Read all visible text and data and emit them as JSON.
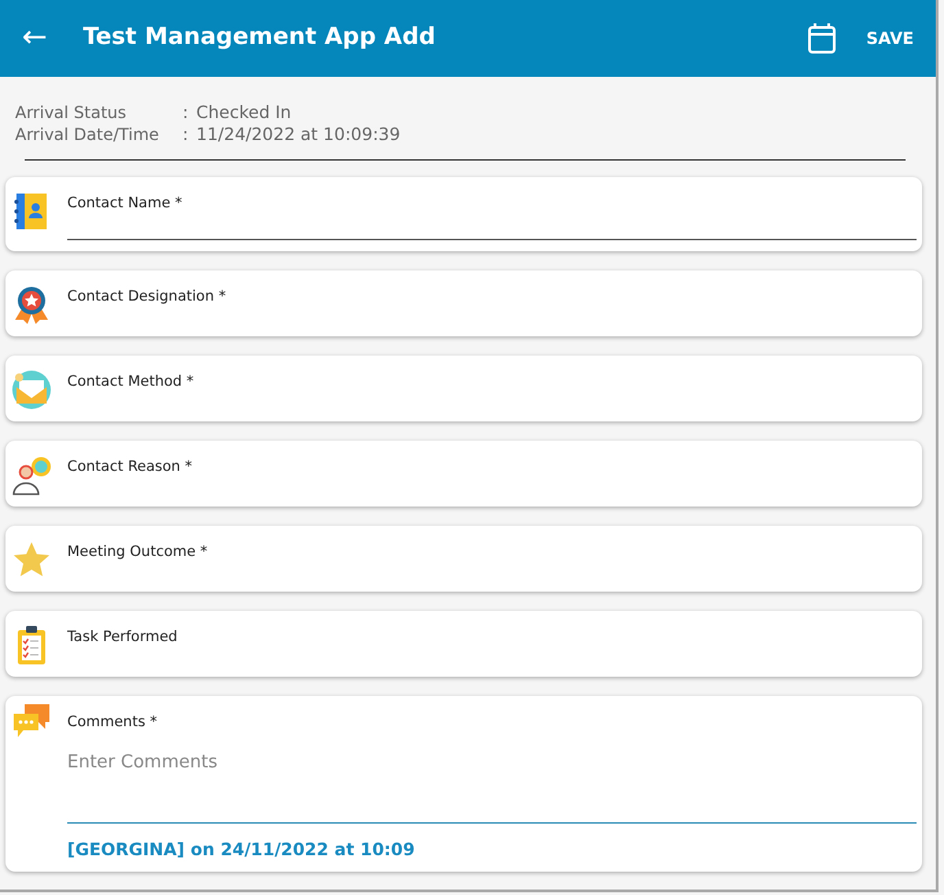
{
  "app_bar": {
    "back": "←",
    "title": "Test Management App Add",
    "action": "SAVE"
  },
  "arrival": [
    {
      "label": "Arrival Status",
      "separator": ":",
      "value": "Checked In"
    },
    {
      "label": "Arrival Date/Time",
      "separator": ":",
      "value": "11/24/2022 at 10:09:39"
    }
  ],
  "fields": [
    {
      "kind": "input",
      "label": "Contact Name *"
    },
    {
      "kind": "picker",
      "label": "Contact Designation *"
    },
    {
      "kind": "picker",
      "label": "Contact Method *"
    },
    {
      "kind": "picker",
      "label": "Contact Reason *"
    },
    {
      "kind": "picker",
      "label": "Meeting Outcome *"
    },
    {
      "kind": "picker",
      "label": "Task Performed"
    },
    {
      "kind": "textarea",
      "label": "Comments *",
      "placeholder": "Enter Comments",
      "note": "[GEORGINA] on 24/11/2022 at 10:09"
    }
  ]
}
